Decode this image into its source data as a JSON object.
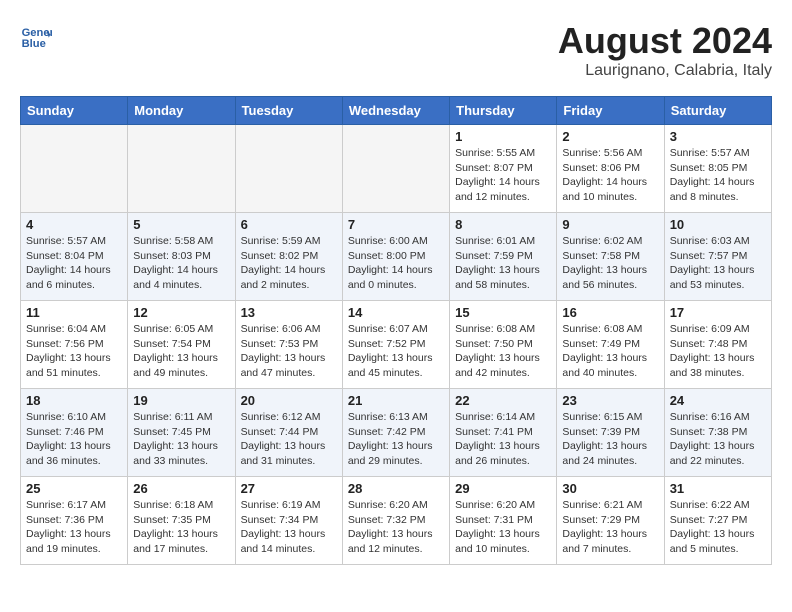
{
  "header": {
    "logo_line1": "General",
    "logo_line2": "Blue",
    "month_title": "August 2024",
    "location": "Laurignano, Calabria, Italy"
  },
  "weekdays": [
    "Sunday",
    "Monday",
    "Tuesday",
    "Wednesday",
    "Thursday",
    "Friday",
    "Saturday"
  ],
  "weeks": [
    [
      {
        "day": "",
        "info": ""
      },
      {
        "day": "",
        "info": ""
      },
      {
        "day": "",
        "info": ""
      },
      {
        "day": "",
        "info": ""
      },
      {
        "day": "1",
        "info": "Sunrise: 5:55 AM\nSunset: 8:07 PM\nDaylight: 14 hours\nand 12 minutes."
      },
      {
        "day": "2",
        "info": "Sunrise: 5:56 AM\nSunset: 8:06 PM\nDaylight: 14 hours\nand 10 minutes."
      },
      {
        "day": "3",
        "info": "Sunrise: 5:57 AM\nSunset: 8:05 PM\nDaylight: 14 hours\nand 8 minutes."
      }
    ],
    [
      {
        "day": "4",
        "info": "Sunrise: 5:57 AM\nSunset: 8:04 PM\nDaylight: 14 hours\nand 6 minutes."
      },
      {
        "day": "5",
        "info": "Sunrise: 5:58 AM\nSunset: 8:03 PM\nDaylight: 14 hours\nand 4 minutes."
      },
      {
        "day": "6",
        "info": "Sunrise: 5:59 AM\nSunset: 8:02 PM\nDaylight: 14 hours\nand 2 minutes."
      },
      {
        "day": "7",
        "info": "Sunrise: 6:00 AM\nSunset: 8:00 PM\nDaylight: 14 hours\nand 0 minutes."
      },
      {
        "day": "8",
        "info": "Sunrise: 6:01 AM\nSunset: 7:59 PM\nDaylight: 13 hours\nand 58 minutes."
      },
      {
        "day": "9",
        "info": "Sunrise: 6:02 AM\nSunset: 7:58 PM\nDaylight: 13 hours\nand 56 minutes."
      },
      {
        "day": "10",
        "info": "Sunrise: 6:03 AM\nSunset: 7:57 PM\nDaylight: 13 hours\nand 53 minutes."
      }
    ],
    [
      {
        "day": "11",
        "info": "Sunrise: 6:04 AM\nSunset: 7:56 PM\nDaylight: 13 hours\nand 51 minutes."
      },
      {
        "day": "12",
        "info": "Sunrise: 6:05 AM\nSunset: 7:54 PM\nDaylight: 13 hours\nand 49 minutes."
      },
      {
        "day": "13",
        "info": "Sunrise: 6:06 AM\nSunset: 7:53 PM\nDaylight: 13 hours\nand 47 minutes."
      },
      {
        "day": "14",
        "info": "Sunrise: 6:07 AM\nSunset: 7:52 PM\nDaylight: 13 hours\nand 45 minutes."
      },
      {
        "day": "15",
        "info": "Sunrise: 6:08 AM\nSunset: 7:50 PM\nDaylight: 13 hours\nand 42 minutes."
      },
      {
        "day": "16",
        "info": "Sunrise: 6:08 AM\nSunset: 7:49 PM\nDaylight: 13 hours\nand 40 minutes."
      },
      {
        "day": "17",
        "info": "Sunrise: 6:09 AM\nSunset: 7:48 PM\nDaylight: 13 hours\nand 38 minutes."
      }
    ],
    [
      {
        "day": "18",
        "info": "Sunrise: 6:10 AM\nSunset: 7:46 PM\nDaylight: 13 hours\nand 36 minutes."
      },
      {
        "day": "19",
        "info": "Sunrise: 6:11 AM\nSunset: 7:45 PM\nDaylight: 13 hours\nand 33 minutes."
      },
      {
        "day": "20",
        "info": "Sunrise: 6:12 AM\nSunset: 7:44 PM\nDaylight: 13 hours\nand 31 minutes."
      },
      {
        "day": "21",
        "info": "Sunrise: 6:13 AM\nSunset: 7:42 PM\nDaylight: 13 hours\nand 29 minutes."
      },
      {
        "day": "22",
        "info": "Sunrise: 6:14 AM\nSunset: 7:41 PM\nDaylight: 13 hours\nand 26 minutes."
      },
      {
        "day": "23",
        "info": "Sunrise: 6:15 AM\nSunset: 7:39 PM\nDaylight: 13 hours\nand 24 minutes."
      },
      {
        "day": "24",
        "info": "Sunrise: 6:16 AM\nSunset: 7:38 PM\nDaylight: 13 hours\nand 22 minutes."
      }
    ],
    [
      {
        "day": "25",
        "info": "Sunrise: 6:17 AM\nSunset: 7:36 PM\nDaylight: 13 hours\nand 19 minutes."
      },
      {
        "day": "26",
        "info": "Sunrise: 6:18 AM\nSunset: 7:35 PM\nDaylight: 13 hours\nand 17 minutes."
      },
      {
        "day": "27",
        "info": "Sunrise: 6:19 AM\nSunset: 7:34 PM\nDaylight: 13 hours\nand 14 minutes."
      },
      {
        "day": "28",
        "info": "Sunrise: 6:20 AM\nSunset: 7:32 PM\nDaylight: 13 hours\nand 12 minutes."
      },
      {
        "day": "29",
        "info": "Sunrise: 6:20 AM\nSunset: 7:31 PM\nDaylight: 13 hours\nand 10 minutes."
      },
      {
        "day": "30",
        "info": "Sunrise: 6:21 AM\nSunset: 7:29 PM\nDaylight: 13 hours\nand 7 minutes."
      },
      {
        "day": "31",
        "info": "Sunrise: 6:22 AM\nSunset: 7:27 PM\nDaylight: 13 hours\nand 5 minutes."
      }
    ]
  ]
}
